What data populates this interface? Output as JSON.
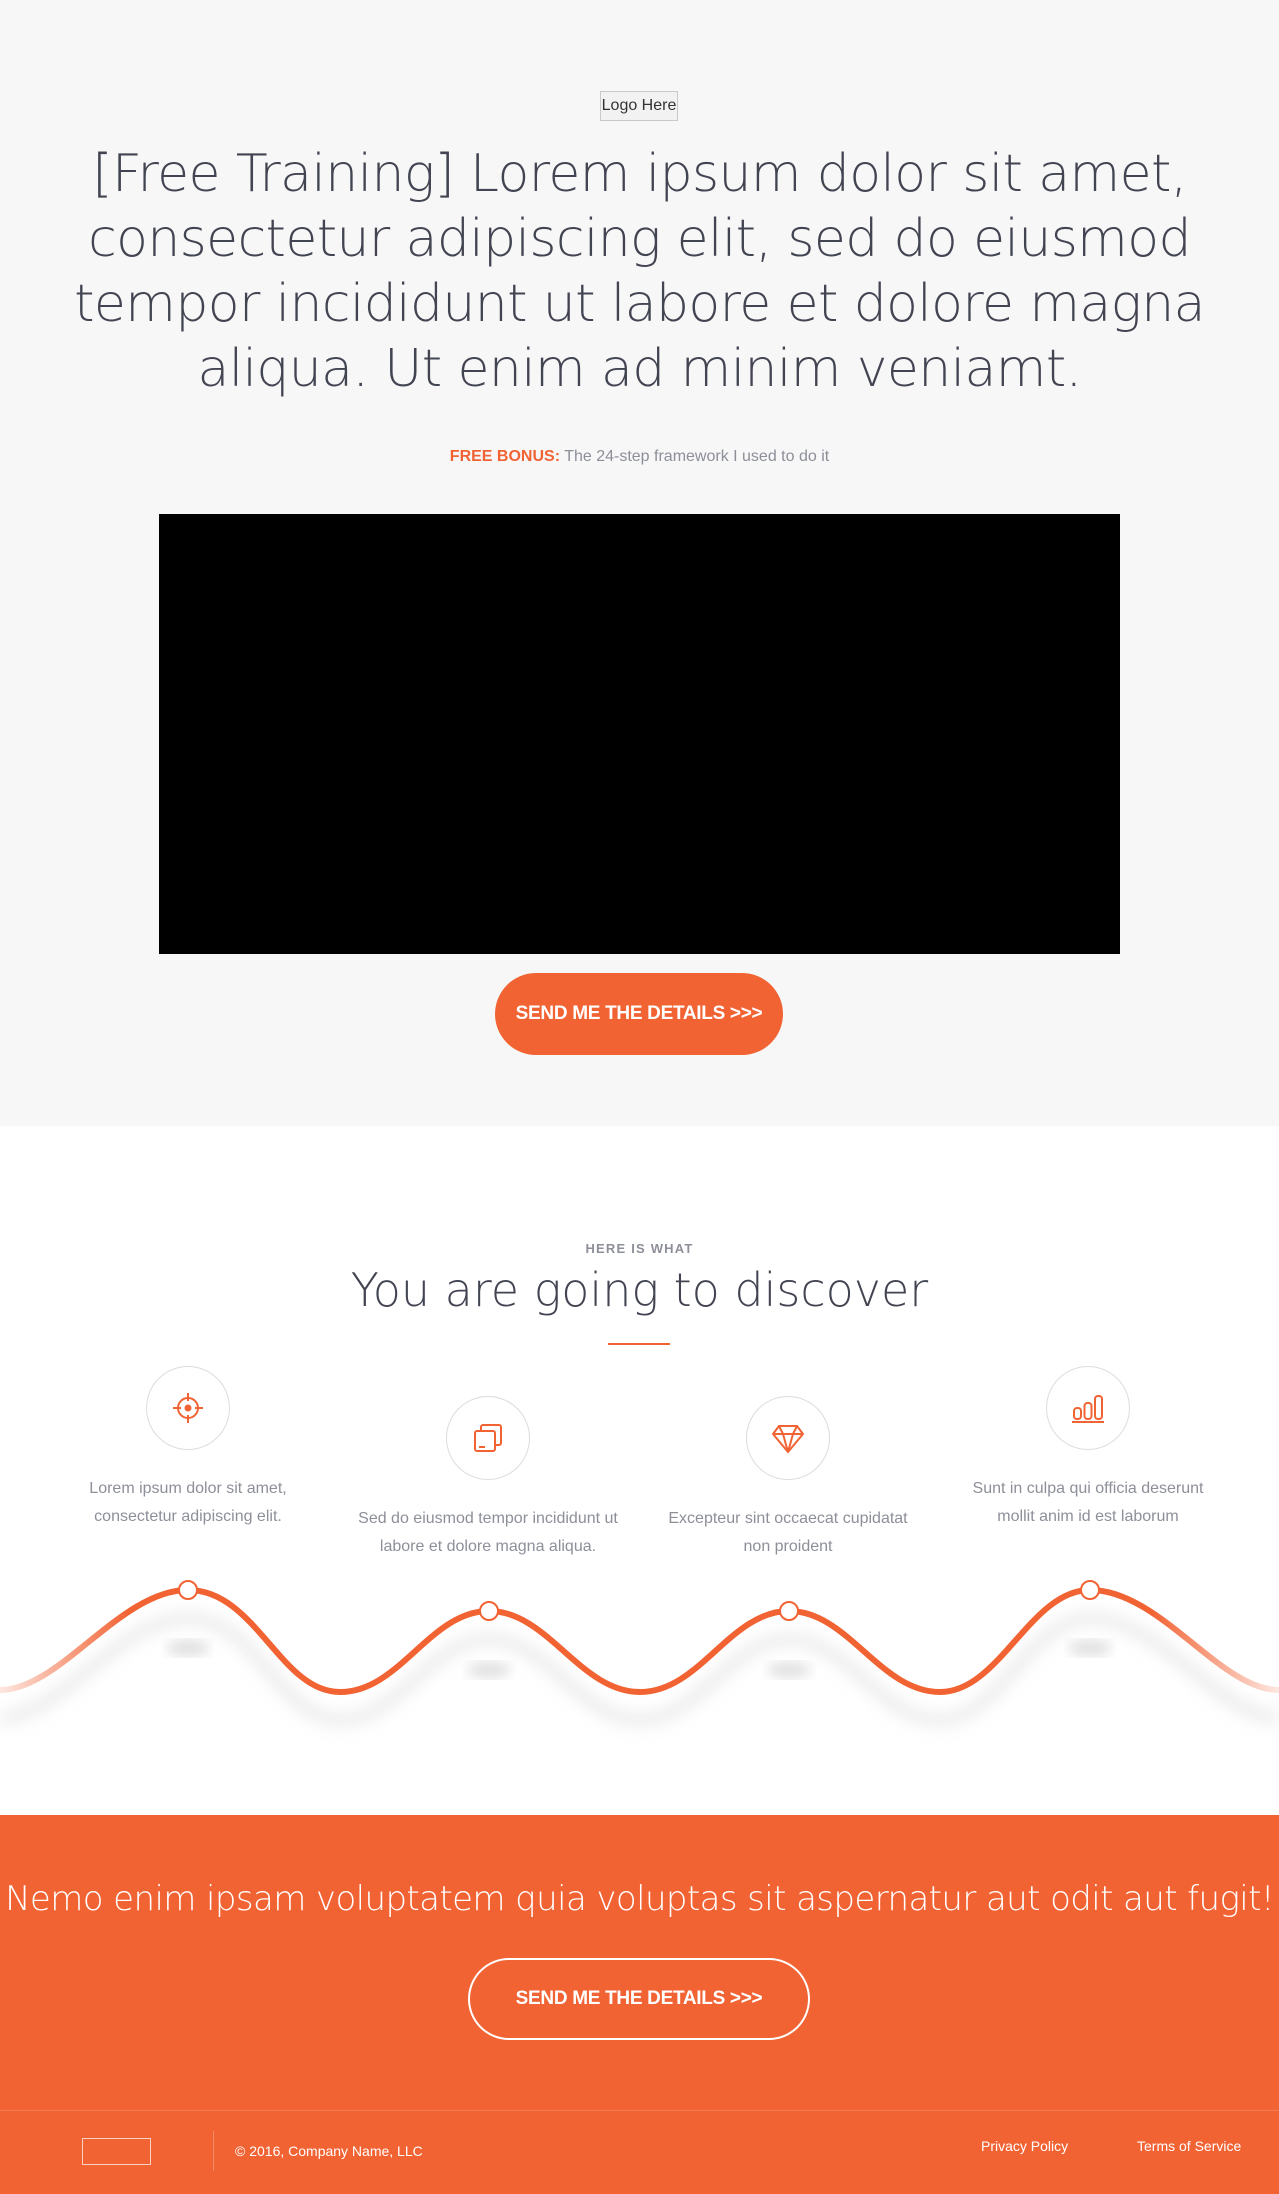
{
  "hero": {
    "logo_text": "Logo Here",
    "headline": "[Free Training] Lorem ipsum dolor sit amet, consectetur adipiscing elit, sed do eiusmod tempor incididunt ut labore et dolore magna aliqua. Ut enim ad minim veniamt.",
    "bonus_label": "FREE BONUS:",
    "bonus_text": " The 24-step framework I used to do it",
    "cta_label": "SEND ME THE DETAILS >>>"
  },
  "discover": {
    "eyebrow": "HERE IS WHAT",
    "title": "You are going to discover",
    "features": [
      {
        "icon": "crosshair-icon",
        "text": "Lorem ipsum dolor sit amet, consectetur adipiscing elit."
      },
      {
        "icon": "layers-icon",
        "text": "Sed do eiusmod tempor incididunt ut labore et dolore magna aliqua."
      },
      {
        "icon": "diamond-icon",
        "text": "Excepteur sint occaecat cupidatat non proident"
      },
      {
        "icon": "bar-chart-icon",
        "text": "Sunt in culpa qui officia deserunt mollit anim id est laborum"
      }
    ]
  },
  "cta": {
    "text": "Nemo enim ipsam voluptatem quia voluptas sit aspernatur aut odit aut fugit!",
    "button_label": "SEND ME THE DETAILS >>>"
  },
  "footer": {
    "copyright": "© 2016, Company Name, LLC",
    "links": [
      "Privacy Policy",
      "Terms of Service"
    ]
  },
  "colors": {
    "accent": "#f26334",
    "text_dark": "#424452",
    "text_muted": "#8d8f99",
    "hero_bg": "#f7f7f7"
  }
}
